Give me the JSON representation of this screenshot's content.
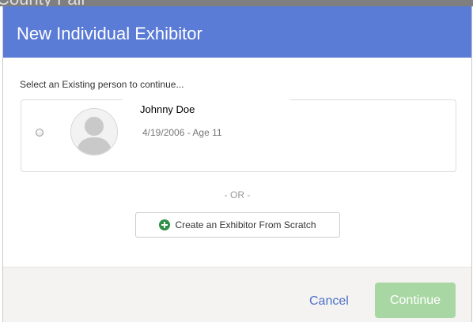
{
  "background": {
    "title_fragment": "County Fair"
  },
  "modal": {
    "title": "New Individual Exhibitor",
    "instructions": "Select an Existing person to continue...",
    "person": {
      "name": "Johnny Doe",
      "dob_age": "4/19/2006 - Age 11"
    },
    "or_divider": "- OR -",
    "create_button_label": "Create an Exhibitor From Scratch",
    "cancel_label": "Cancel",
    "continue_label": "Continue"
  },
  "colors": {
    "header": "#5a7bd6",
    "continue_disabled": "#a9d7a3",
    "plus_icon": "#2f8f46",
    "link": "#4a70c8"
  }
}
